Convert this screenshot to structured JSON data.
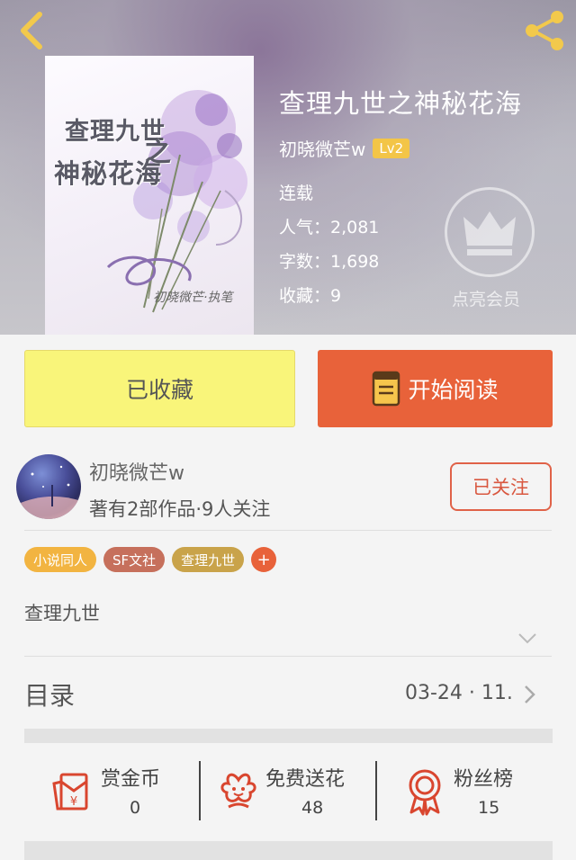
{
  "header": {
    "back_icon": "chevron-left-icon",
    "share_icon": "share-icon"
  },
  "book": {
    "title": "查理九世之神秘花海",
    "author": "初晓微芒w",
    "level": "Lv2",
    "status": "连载",
    "popularity": "人气：2,081",
    "word_count": "字数：1,698",
    "favorites": "收藏：9",
    "vip_label": "点亮会员"
  },
  "cover": {
    "line1": "查理九世",
    "zhi": "之",
    "line2": "神秘花海",
    "author_mark": "初晓微芒·执笔"
  },
  "actions": {
    "collect_label": "已收藏",
    "read_label": "开始阅读"
  },
  "author_card": {
    "name": "初晓微芒w",
    "stats": "著有2部作品·9人关注",
    "follow_label": "已关注"
  },
  "tags": [
    {
      "label": "小说同人",
      "color": "#f2b441"
    },
    {
      "label": "SF文社",
      "color": "#c6705c"
    },
    {
      "label": "查理九世",
      "color": "#c9a34a"
    },
    {
      "label": "+",
      "color": "#e8623a"
    }
  ],
  "description": "查理九世",
  "toc": {
    "label": "目录",
    "date": "03-24 · 11."
  },
  "stats": [
    {
      "label": "赏金币",
      "value": "0",
      "icon": "red-envelope-icon"
    },
    {
      "label": "免费送花",
      "value": "48",
      "icon": "flower-icon"
    },
    {
      "label": "粉丝榜",
      "value": "15",
      "icon": "ribbon-badge-icon"
    }
  ],
  "colors": {
    "accent": "#e8623a",
    "collect_bg": "#f9f57a",
    "header_icon": "#f2c94c"
  }
}
